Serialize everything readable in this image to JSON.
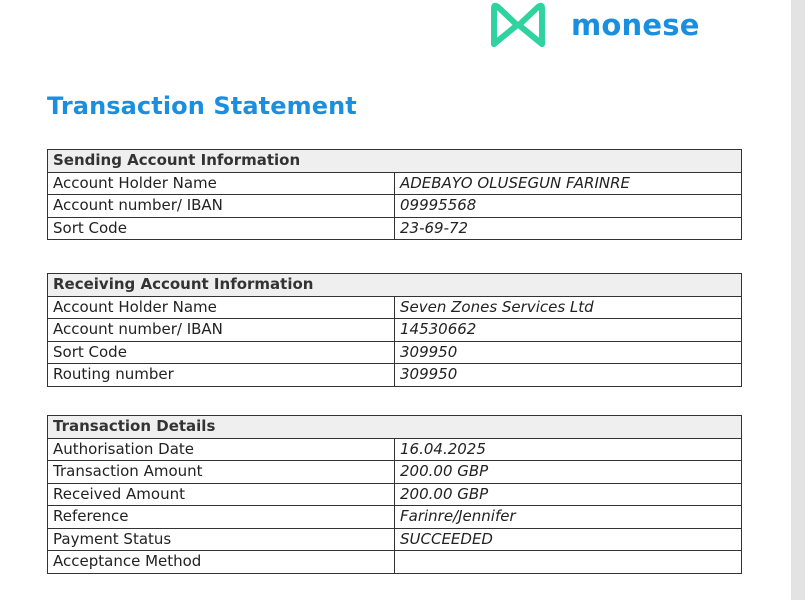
{
  "brand": {
    "name": "monese"
  },
  "title": "Transaction Statement",
  "sections": [
    {
      "heading": "Sending Account Information",
      "rows": [
        {
          "label": "Account Holder Name",
          "value": "ADEBAYO OLUSEGUN FARINRE"
        },
        {
          "label": "Account number/ IBAN",
          "value": "09995568"
        },
        {
          "label": "Sort Code",
          "value": "23-69-72"
        }
      ]
    },
    {
      "heading": "Receiving Account Information",
      "rows": [
        {
          "label": "Account Holder Name",
          "value": "Seven Zones Services Ltd"
        },
        {
          "label": "Account number/ IBAN",
          "value": "14530662"
        },
        {
          "label": "Sort Code",
          "value": "309950"
        },
        {
          "label": "Routing number",
          "value": "309950"
        }
      ]
    },
    {
      "heading": "Transaction Details",
      "rows": [
        {
          "label": "Authorisation Date",
          "value": "16.04.2025"
        },
        {
          "label": "Transaction Amount",
          "value": "200.00 GBP"
        },
        {
          "label": "Received Amount",
          "value": "200.00 GBP"
        },
        {
          "label": "Reference",
          "value": "Farinre/Jennifer"
        },
        {
          "label": "Payment Status",
          "value": "SUCCEEDED"
        },
        {
          "label": "Acceptance Method",
          "value": ""
        }
      ]
    }
  ],
  "colors": {
    "brand_green": "#2ed3a0",
    "brand_blue": "#1a8fe0",
    "header_bg": "#efefef"
  },
  "icons": {
    "logo": "monese-logo-icon"
  }
}
